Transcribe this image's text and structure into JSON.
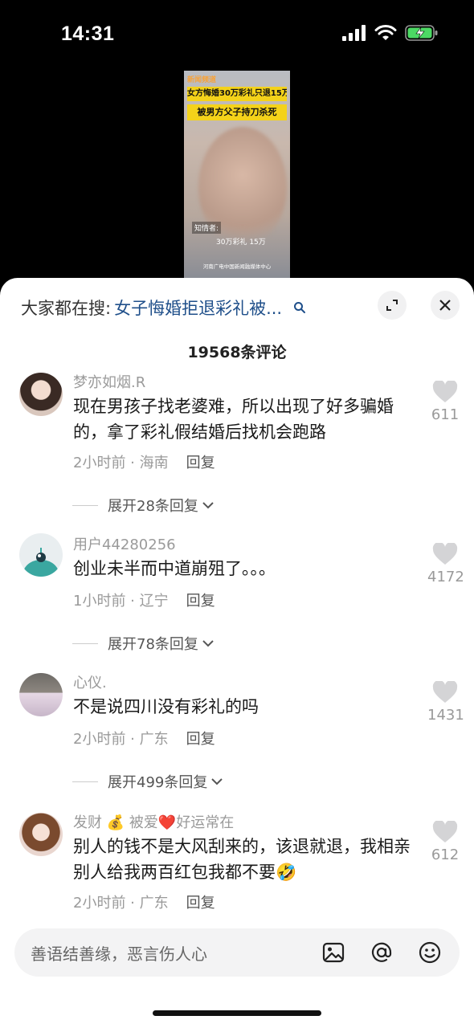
{
  "status_bar": {
    "time": "14:31"
  },
  "video": {
    "logo": "新闻频道",
    "title_line1": "女方悔婚30万彩礼只退15万",
    "title_line2": "被男方父子持刀杀死",
    "informant": "知情者:",
    "subtitle": "30万彩礼 15万",
    "footer": "河南广电中国新闻融媒体中心"
  },
  "sheet": {
    "search_label": "大家都在搜:",
    "search_term": "女子悔婚拒退彩礼被...",
    "comments_count": "19568条评论"
  },
  "comments": [
    {
      "user": "梦亦如烟.R",
      "text": "现在男孩子找老婆难，所以出现了好多骗婚的，拿了彩礼假结婚后找机会跑路",
      "meta": "2小时前 · 海南",
      "reply": "回复",
      "likes": "611",
      "expand": "展开28条回复"
    },
    {
      "user": "用户44280256",
      "text": "创业未半而中道崩殂了。。。",
      "meta": "1小时前 · 辽宁",
      "reply": "回复",
      "likes": "4172",
      "expand": "展开78条回复"
    },
    {
      "user": "心仪.",
      "text": "不是说四川没有彩礼的吗",
      "meta": "2小时前 · 广东",
      "reply": "回复",
      "likes": "1431",
      "expand": "展开499条回复"
    },
    {
      "user_parts": [
        "发财",
        "💰",
        "被爱",
        "❤️",
        "好运常在"
      ],
      "text": "别人的钱不是大风刮来的，该退就退，我相亲别人给我两百红包我都不要🤣",
      "meta": "2小时前 · 广东",
      "reply": "回复",
      "likes": "612"
    }
  ],
  "input": {
    "placeholder": "善语结善缘，恶言伤人心"
  }
}
